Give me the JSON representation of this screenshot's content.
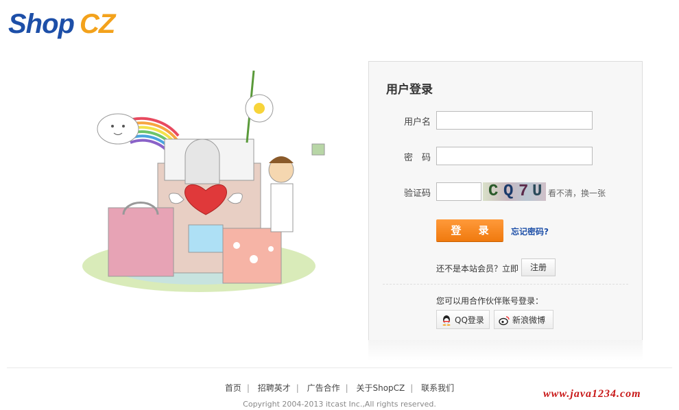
{
  "logo": {
    "part1": "Shop",
    "part2": "CZ"
  },
  "login": {
    "title": "用户登录",
    "username_label": "用户名",
    "password_label": "密　码",
    "captcha_label": "验证码",
    "captcha_chars": [
      "C",
      "Q",
      "7",
      "U"
    ],
    "captcha_refresh": "看不清，换一张",
    "login_button": "登 录",
    "forgot_link": "忘记密码?",
    "not_member": "还不是本站会员？立即",
    "register_button": "注册",
    "partner_text": "您可以用合作伙伴账号登录：",
    "qq_login": "QQ登录",
    "weibo_login": "新浪微博"
  },
  "footer": {
    "links": [
      "首页",
      "招聘英才",
      "广告合作",
      "关于ShopCZ",
      "联系我们"
    ],
    "copyright": "Copyright 2004-2013 itcast Inc.,All rights reserved."
  },
  "watermark": "www.java1234.com",
  "colors": {
    "brand_blue": "#1d4fa8",
    "brand_orange": "#f3a21c",
    "button_orange": "#f07a0e",
    "watermark_red": "#c81818"
  }
}
